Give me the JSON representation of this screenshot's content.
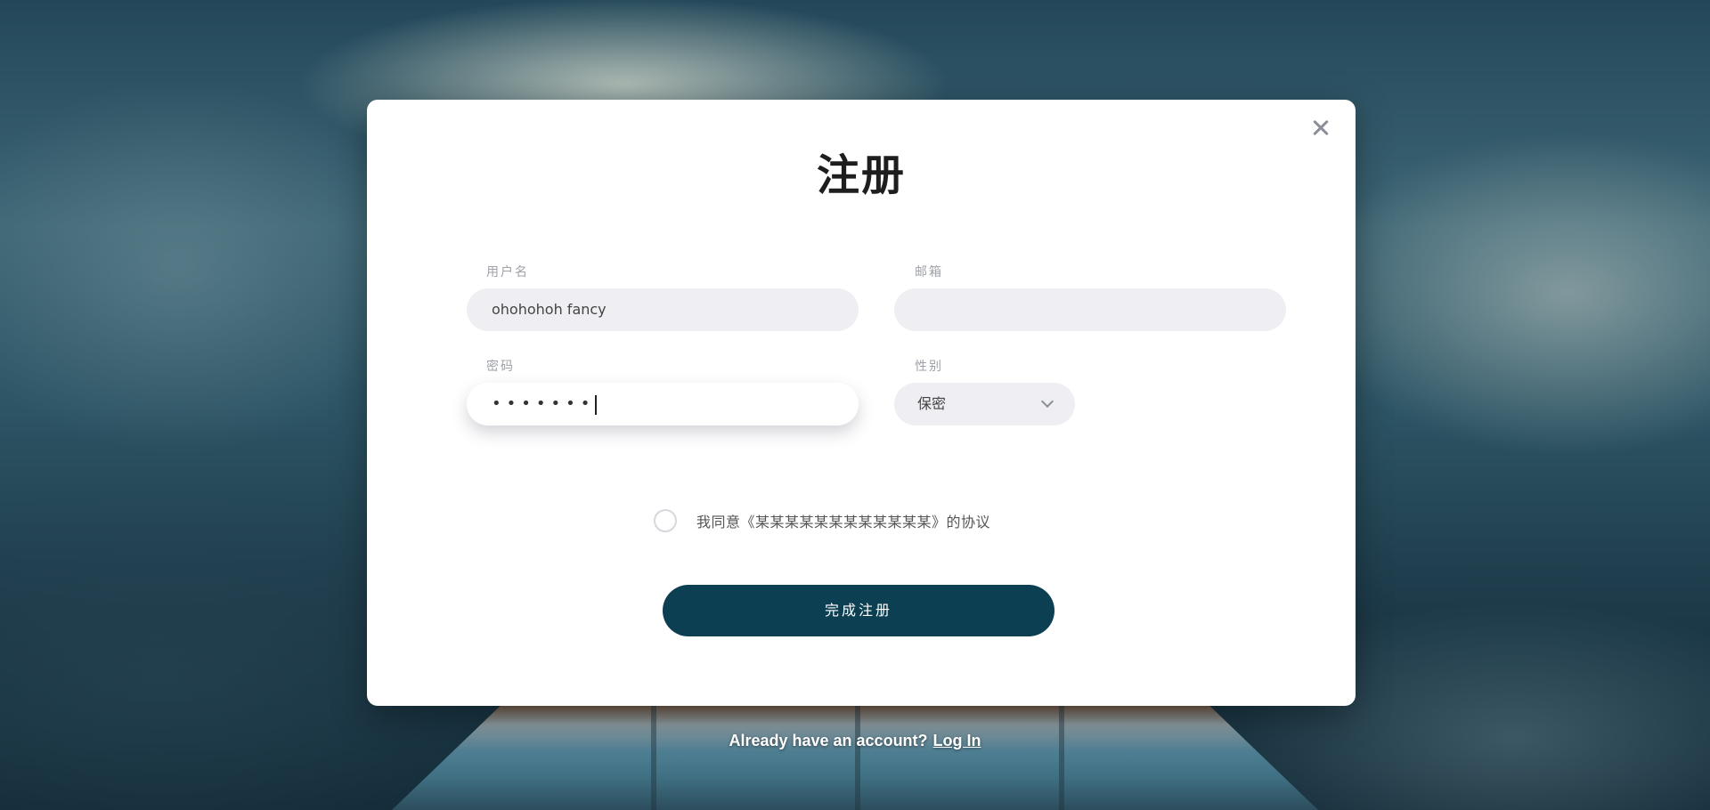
{
  "modal": {
    "title": "注册",
    "close_icon": "close-icon"
  },
  "form": {
    "username": {
      "label": "用户名",
      "value": "ohohohoh fancy"
    },
    "email": {
      "label": "邮箱",
      "value": ""
    },
    "password": {
      "label": "密码",
      "masked_value": "•••••••"
    },
    "gender": {
      "label": "性别",
      "selected": "保密",
      "icon": "chevron-down-icon"
    }
  },
  "agreement": {
    "text": "我同意《某某某某某某某某某某某某》的协议",
    "checked": false
  },
  "submit": {
    "label": "完成注册",
    "color": "#0c3f52"
  },
  "footer": {
    "prompt": "Already have an account?",
    "login_link": "Log In"
  }
}
